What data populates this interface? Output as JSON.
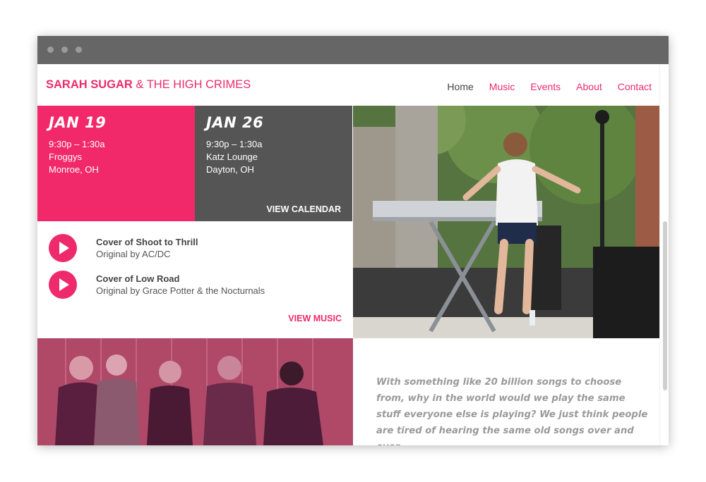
{
  "brand": {
    "name_bold": "SARAH SUGAR",
    "name_rest": " & THE HIGH CRIMES"
  },
  "nav": [
    {
      "label": "Home"
    },
    {
      "label": "Music"
    },
    {
      "label": "Events"
    },
    {
      "label": "About"
    },
    {
      "label": "Contact"
    }
  ],
  "events": [
    {
      "date": "JAN 19",
      "time": "9:30p – 1:30a",
      "venue": "Froggys",
      "city": "Monroe, OH"
    },
    {
      "date": "JAN 26",
      "time": "9:30p – 1:30a",
      "venue": "Katz Lounge",
      "city": "Dayton, OH"
    }
  ],
  "view_calendar": "VIEW CALENDAR",
  "tracks": [
    {
      "title": "Cover of Shoot to Thrill",
      "subtitle": "Original by AC/DC"
    },
    {
      "title": "Cover of Low Road",
      "subtitle": "Original by Grace Potter & the Nocturnals"
    }
  ],
  "view_music": "VIEW MUSIC",
  "quote": "With something like 20 billion songs to choose from, why in the world would we play the same stuff everyone else is playing? We just think people are tired of hearing the same old songs over and over.",
  "colors": {
    "accent": "#ee2a6d",
    "dark_panel": "#555555",
    "chrome": "#666666"
  }
}
